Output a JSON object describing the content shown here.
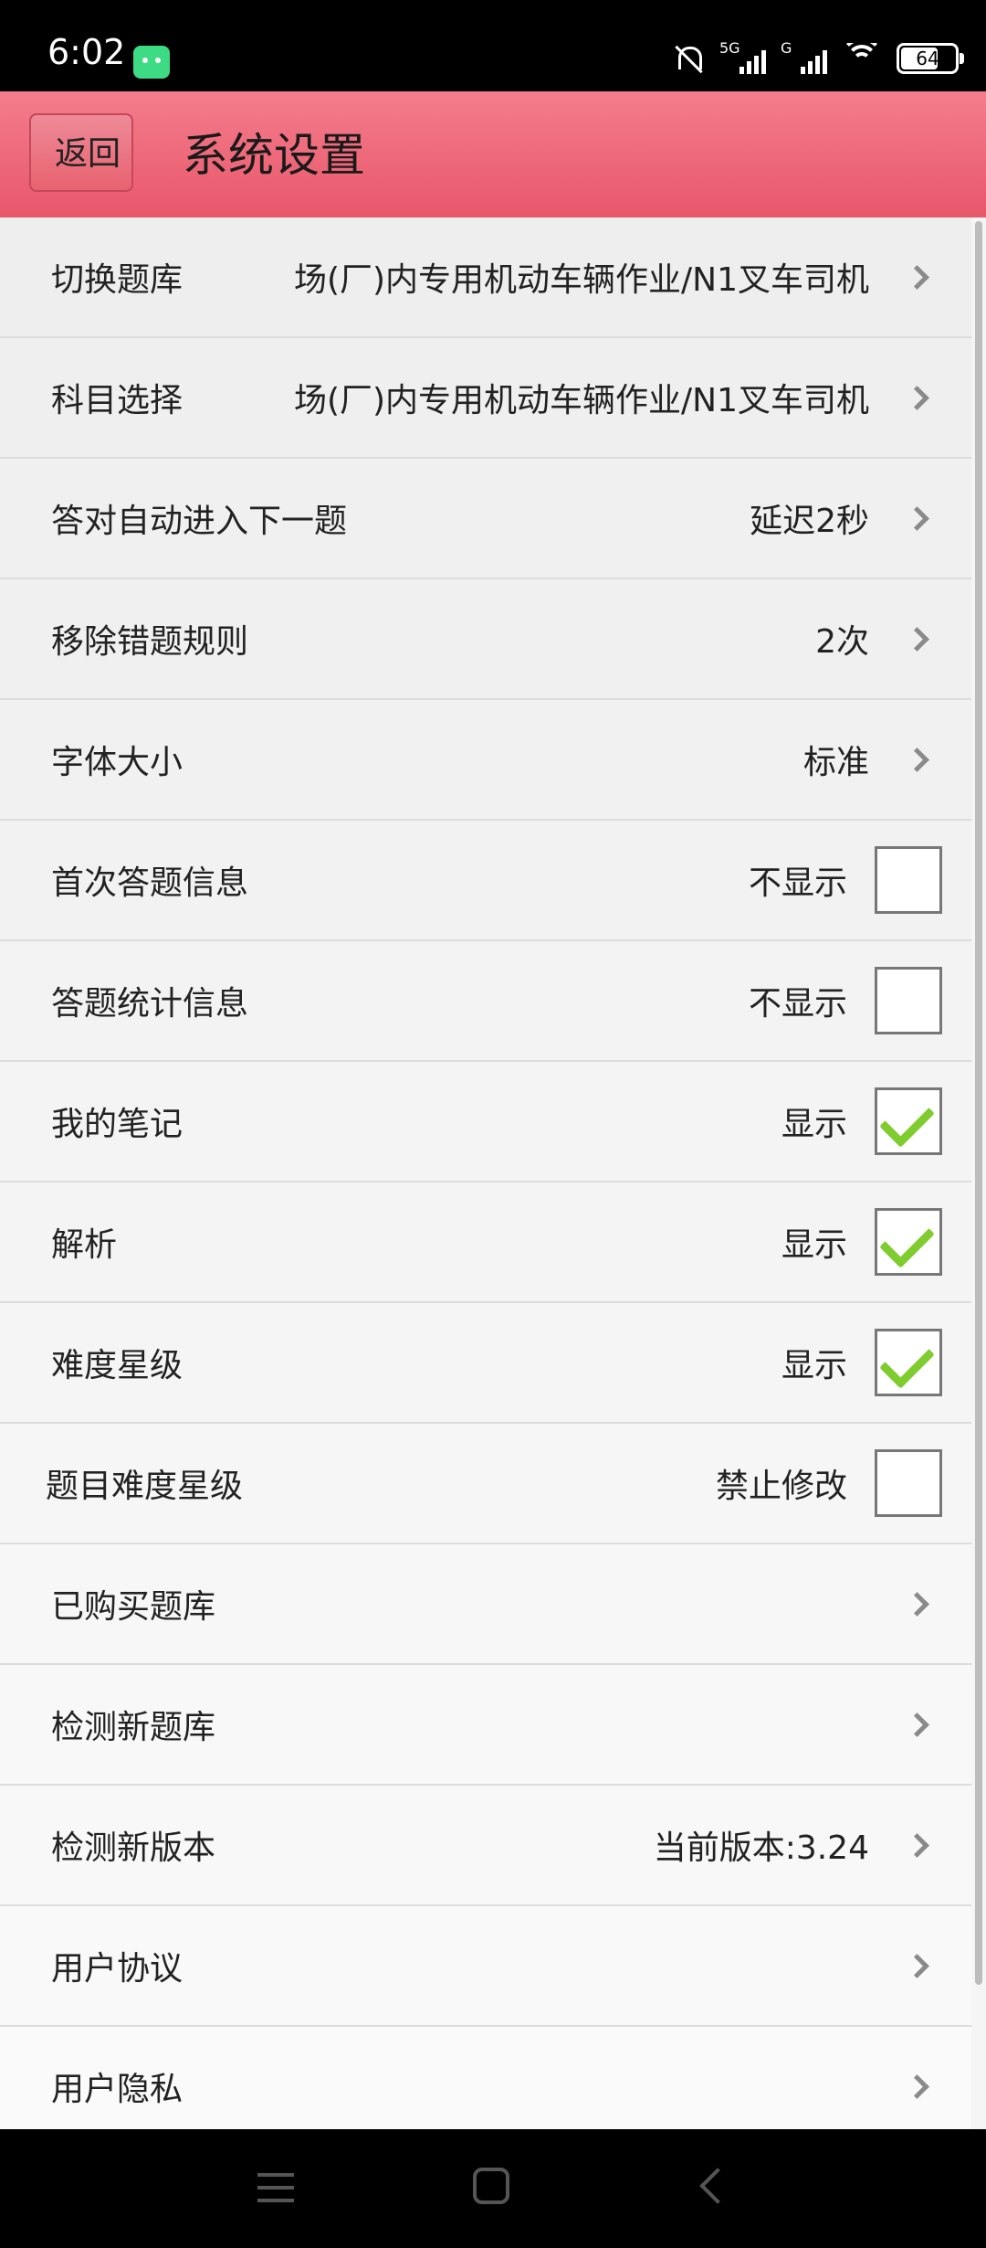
{
  "status_bar": {
    "time": "6:02",
    "network1": "5G",
    "network2": "G",
    "battery": "64",
    "icons": [
      "android-icon",
      "mute-icon",
      "signal-icon",
      "wifi-icon",
      "battery-icon"
    ]
  },
  "header": {
    "back_label": "返回",
    "title": "系统设置"
  },
  "settings": [
    {
      "label": "切换题库",
      "value": "场(厂)内专用机动车辆作业/N1叉车司机",
      "control": "chevron"
    },
    {
      "label": "科目选择",
      "value": "场(厂)内专用机动车辆作业/N1叉车司机",
      "control": "chevron"
    },
    {
      "label": "答对自动进入下一题",
      "value": "延迟2秒",
      "control": "chevron"
    },
    {
      "label": "移除错题规则",
      "value": "2次",
      "control": "chevron"
    },
    {
      "label": "字体大小",
      "value": "标准",
      "control": "chevron"
    },
    {
      "label": "首次答题信息",
      "value": "不显示",
      "control": "checkbox",
      "checked": false
    },
    {
      "label": "答题统计信息",
      "value": "不显示",
      "control": "checkbox",
      "checked": false
    },
    {
      "label": "我的笔记",
      "value": "显示",
      "control": "checkbox",
      "checked": true
    },
    {
      "label": "解析",
      "value": "显示",
      "control": "checkbox",
      "checked": true
    },
    {
      "label": "难度星级",
      "value": "显示",
      "control": "checkbox",
      "checked": true
    },
    {
      "label": "题目难度星级",
      "value": "禁止修改",
      "control": "checkbox",
      "checked": false
    },
    {
      "label": "已购买题库",
      "value": "",
      "control": "chevron"
    },
    {
      "label": "检测新题库",
      "value": "",
      "control": "chevron"
    },
    {
      "label": "检测新版本",
      "value": "当前版本:3.24",
      "control": "chevron"
    },
    {
      "label": "用户协议",
      "value": "",
      "control": "chevron"
    },
    {
      "label": "用户隐私",
      "value": "",
      "control": "chevron"
    }
  ],
  "colors": {
    "header_accent": "#e8576a",
    "check_green": "#7fcc2e"
  },
  "nav_bar": {
    "icons": [
      "menu-icon",
      "home-icon",
      "back-icon"
    ]
  }
}
